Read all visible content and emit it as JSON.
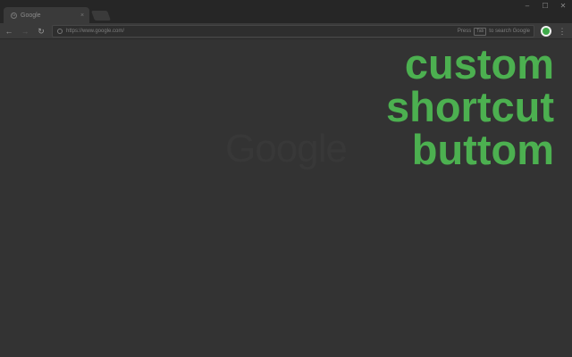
{
  "tab": {
    "title": "Google",
    "close": "×"
  },
  "window_controls": {
    "minimize": "–",
    "maximize": "☐",
    "close": "✕"
  },
  "toolbar": {
    "back": "←",
    "forward": "→",
    "reload": "↻",
    "url": "https://www.google.com/",
    "hint_prefix": "Press",
    "hint_key": "Tab",
    "hint_suffix": "to search Google",
    "menu": "⋮"
  },
  "page": {
    "logo": "Google",
    "search_hint": ""
  },
  "promo": {
    "line1": "custom",
    "line2": "shortcut",
    "line3": "buttom"
  },
  "colors": {
    "accent": "#4cb050",
    "background": "#333333"
  }
}
